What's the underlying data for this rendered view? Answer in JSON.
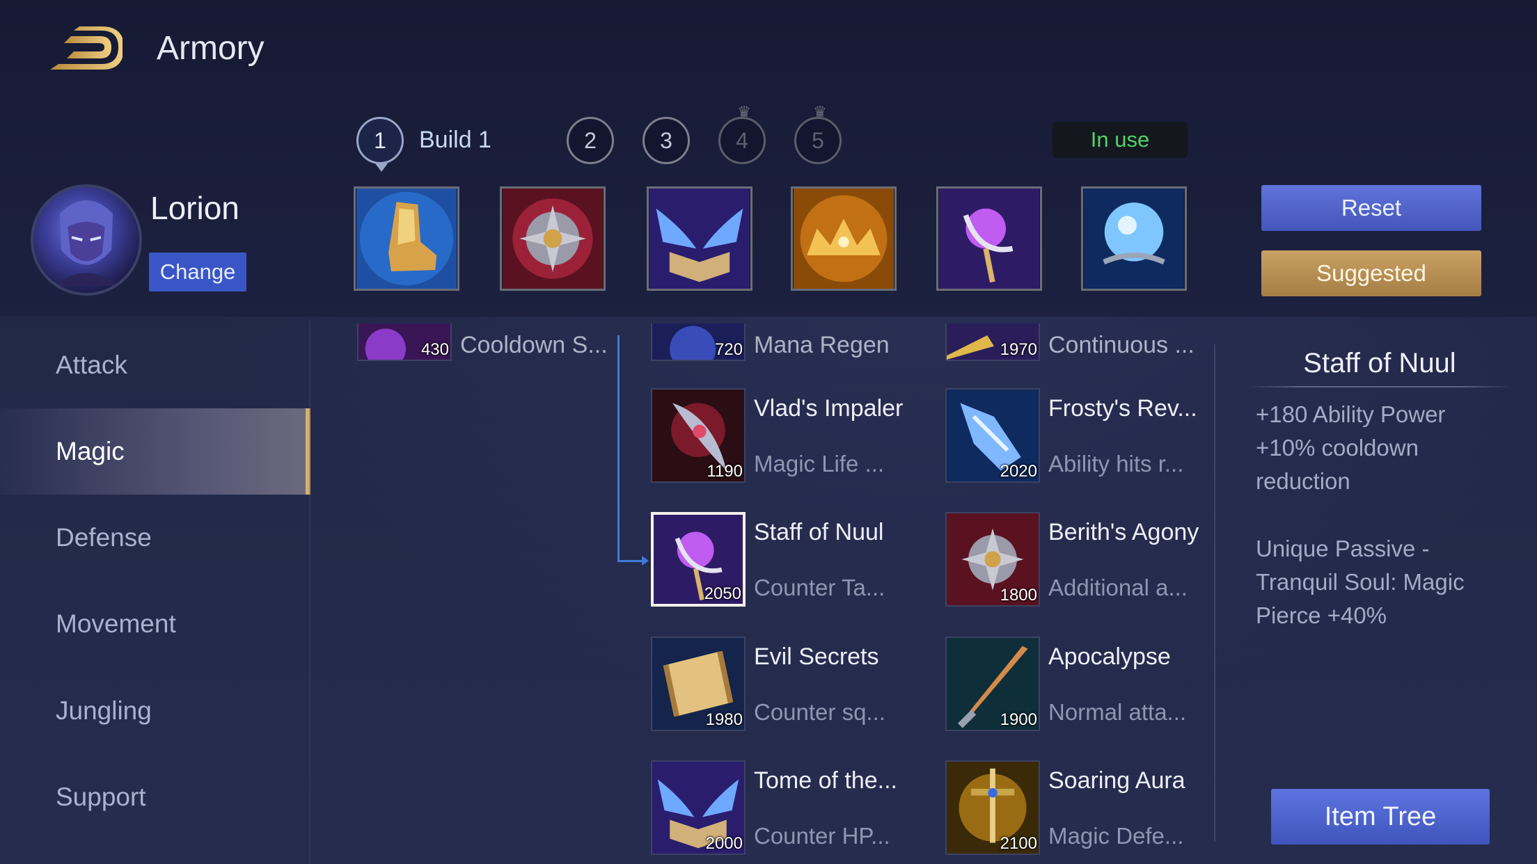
{
  "header": {
    "title": "Armory",
    "back_icon": "back-arrow-icon"
  },
  "builds": {
    "tabs": [
      {
        "number": "1",
        "state": "active"
      },
      {
        "number": "2",
        "state": "available"
      },
      {
        "number": "3",
        "state": "available"
      },
      {
        "number": "4",
        "state": "locked"
      },
      {
        "number": "5",
        "state": "locked"
      }
    ],
    "active_name": "Build 1",
    "status": "In use"
  },
  "hero": {
    "name": "Lorion",
    "change_label": "Change"
  },
  "equipped": [
    "boots-icon",
    "spiked-medal-icon",
    "winged-book-icon",
    "golden-crown-icon",
    "purple-staff-icon",
    "blue-orb-icon"
  ],
  "actions": {
    "reset_label": "Reset",
    "suggested_label": "Suggested",
    "item_tree_label": "Item Tree"
  },
  "categories": [
    {
      "label": "Attack"
    },
    {
      "label": "Magic",
      "active": true
    },
    {
      "label": "Defense"
    },
    {
      "label": "Movement"
    },
    {
      "label": "Jungling"
    },
    {
      "label": "Support"
    }
  ],
  "items": {
    "partial_row": [
      {
        "price": "430",
        "name": "Cooldown S..."
      },
      {
        "price": "720",
        "name": "Mana Regen"
      },
      {
        "price": "1970",
        "name": "Continuous ..."
      }
    ],
    "col2": [
      {
        "name": "Vlad's Impaler",
        "desc": "Magic Life ...",
        "price": "1190"
      },
      {
        "name": "Staff of Nuul",
        "desc": "Counter Ta...",
        "price": "2050"
      },
      {
        "name": "Evil Secrets",
        "desc": "Counter sq...",
        "price": "1980"
      },
      {
        "name": "Tome of the...",
        "desc": "Counter HP...",
        "price": "2000"
      }
    ],
    "col3": [
      {
        "name": "Frosty's Rev...",
        "desc": "Ability hits r...",
        "price": "2020"
      },
      {
        "name": "Berith's Agony",
        "desc": "Additional a...",
        "price": "1800"
      },
      {
        "name": "Apocalypse",
        "desc": "Normal atta...",
        "price": "1900"
      },
      {
        "name": "Soaring Aura",
        "desc": "Magic Defe...",
        "price": "2100"
      }
    ]
  },
  "detail": {
    "title": "Staff of Nuul",
    "stats": [
      "+180 Ability Power",
      "+10% cooldown",
      "reduction"
    ],
    "passive": [
      "Unique Passive -",
      "Tranquil Soul: Magic",
      "Pierce +40%"
    ]
  },
  "colors": {
    "accent_blue": "#4f63cf",
    "accent_gold": "#c9a063",
    "in_use_green": "#4fd36a"
  }
}
